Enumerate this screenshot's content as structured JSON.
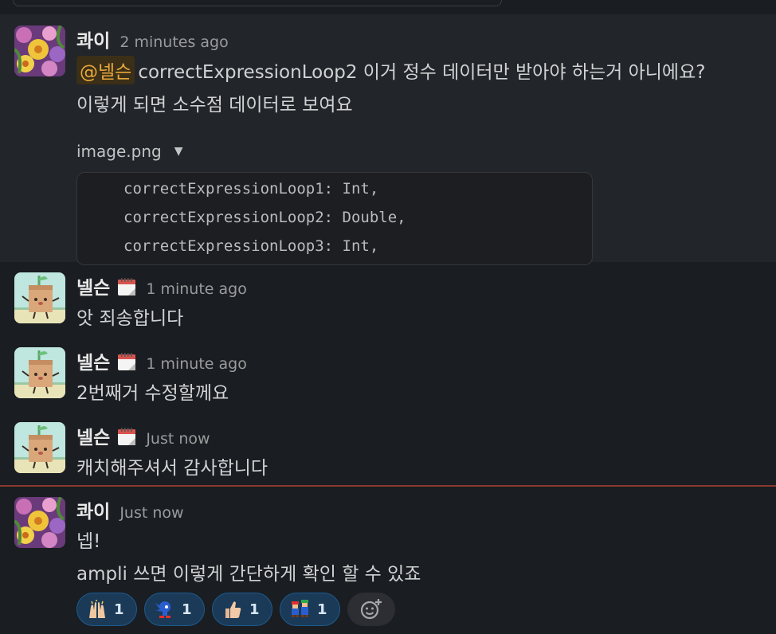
{
  "messages": [
    {
      "author": "콰이",
      "time": "2 minutes ago",
      "mention": "@넬슨",
      "text1": "correctExpressionLoop2 이거 정수 데이터만 받아야 하는거 아니에요?",
      "text2": "이렇게 되면 소수점 데이터로 보여요",
      "file": {
        "name": "image.png",
        "code_lines": [
          "correctExpressionLoop1: Int,",
          "correctExpressionLoop2: Double,",
          "correctExpressionLoop3: Int,"
        ]
      }
    },
    {
      "author": "넬슨",
      "time": "1 minute ago",
      "text": "앗 죄송합니다"
    },
    {
      "author": "넬슨",
      "time": "1 minute ago",
      "text": "2번째거 수정할께요"
    },
    {
      "author": "넬슨",
      "time": "Just now",
      "text": "캐치해주셔서 감사합니다"
    },
    {
      "author": "콰이",
      "time": "Just now",
      "text1": "넵!",
      "text2": "ampli 쓰면 이렇게 간단하게 확인 할 수 있죠"
    }
  ],
  "reactions": [
    {
      "emoji": "raised-hands",
      "count": "1"
    },
    {
      "emoji": "sonic",
      "count": "1"
    },
    {
      "emoji": "thumbs-up",
      "count": "1"
    },
    {
      "emoji": "mario-luigi",
      "count": "1"
    }
  ],
  "colors": {
    "background": "#1a1d21",
    "highlight": "#222529",
    "mention": "#e8a93b",
    "reaction_pill": "#1b3a57",
    "new_divider": "#8a3a2e"
  }
}
